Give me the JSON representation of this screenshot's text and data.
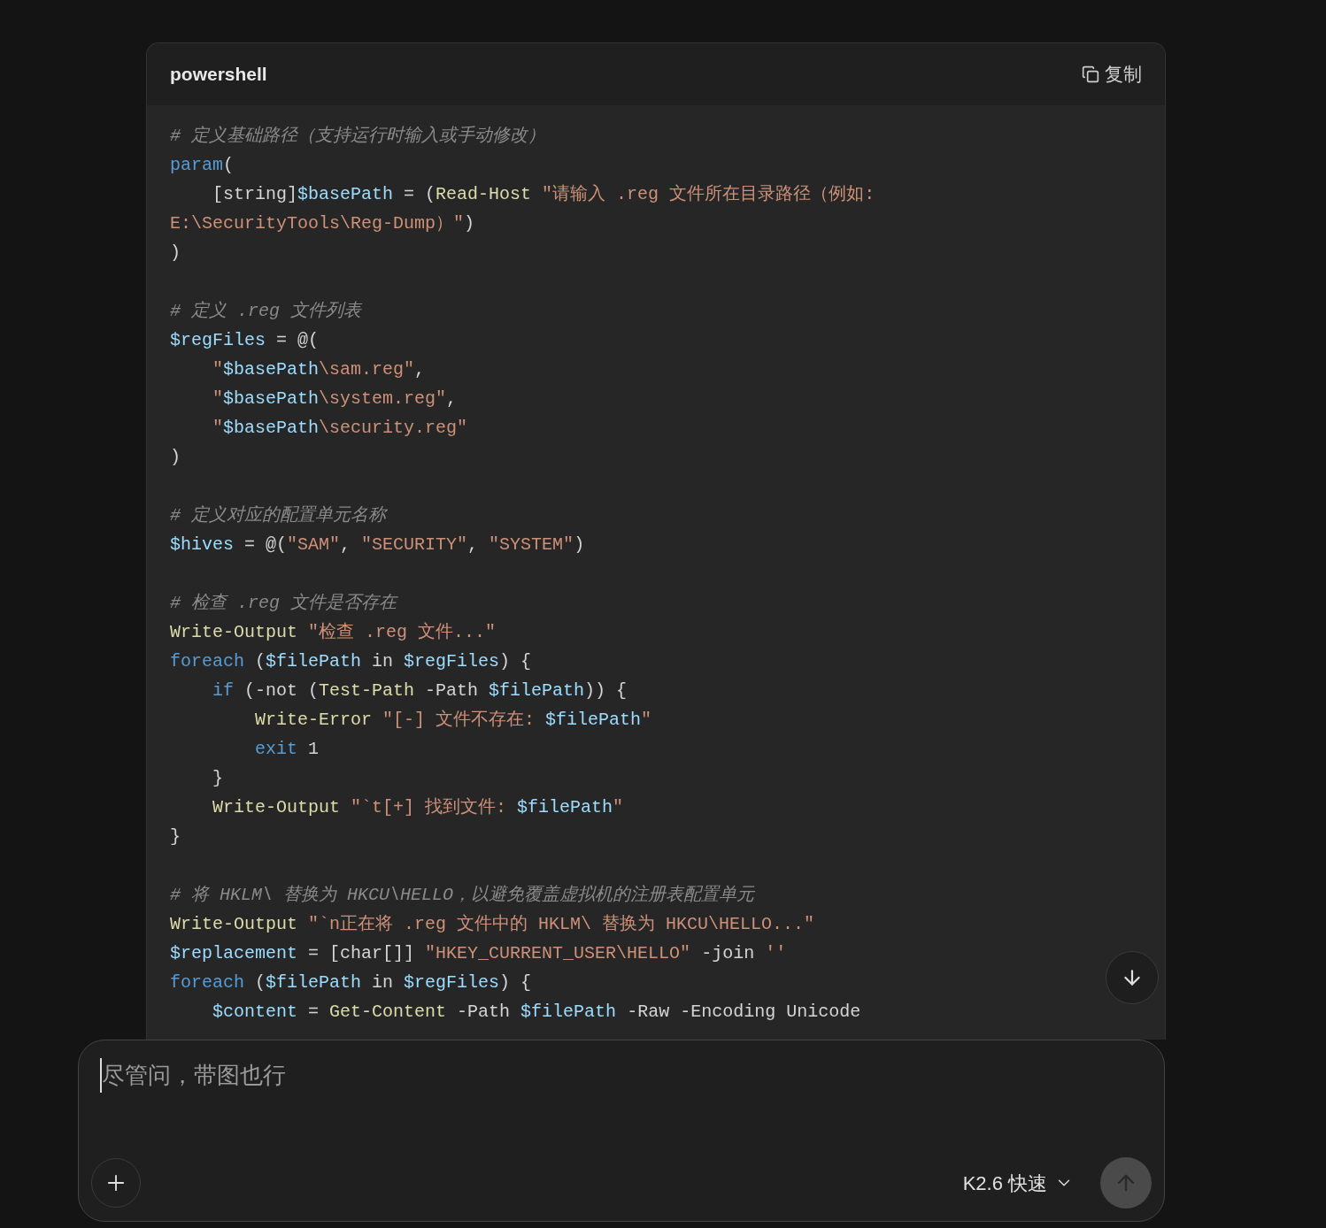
{
  "code_block": {
    "language": "powershell",
    "copy_label": "复制",
    "lines": [
      {
        "kind": "code",
        "tokens": [
          {
            "kind": "comment",
            "text": "# 定义基础路径（支持运行时输入或手动修改）"
          }
        ]
      },
      {
        "kind": "code",
        "tokens": [
          {
            "kind": "keyword",
            "text": "param"
          },
          {
            "kind": "plain",
            "text": "("
          }
        ]
      },
      {
        "kind": "code",
        "tokens": [
          {
            "kind": "plain",
            "text": "    [string]"
          },
          {
            "kind": "variable",
            "text": "$basePath"
          },
          {
            "kind": "plain",
            "text": " = ("
          },
          {
            "kind": "cmdlet",
            "text": "Read-Host"
          },
          {
            "kind": "string",
            "text": " \"请输入 .reg 文件所在目录路径（例如:"
          }
        ]
      },
      {
        "kind": "code",
        "tokens": [
          {
            "kind": "string",
            "text": "E:\\SecurityTools\\Reg-Dump）\""
          },
          {
            "kind": "plain",
            "text": ")"
          }
        ]
      },
      {
        "kind": "code",
        "tokens": [
          {
            "kind": "plain",
            "text": ")"
          }
        ]
      },
      {
        "kind": "blank"
      },
      {
        "kind": "code",
        "tokens": [
          {
            "kind": "comment",
            "text": "# 定义 .reg 文件列表"
          }
        ]
      },
      {
        "kind": "code",
        "tokens": [
          {
            "kind": "variable",
            "text": "$regFiles"
          },
          {
            "kind": "plain",
            "text": " = @("
          }
        ]
      },
      {
        "kind": "code",
        "tokens": [
          {
            "kind": "string",
            "text": "    \""
          },
          {
            "kind": "variable",
            "text": "$basePath"
          },
          {
            "kind": "string",
            "text": "\\sam.reg\""
          },
          {
            "kind": "plain",
            "text": ","
          }
        ]
      },
      {
        "kind": "code",
        "tokens": [
          {
            "kind": "string",
            "text": "    \""
          },
          {
            "kind": "variable",
            "text": "$basePath"
          },
          {
            "kind": "string",
            "text": "\\system.reg\""
          },
          {
            "kind": "plain",
            "text": ","
          }
        ]
      },
      {
        "kind": "code",
        "tokens": [
          {
            "kind": "string",
            "text": "    \""
          },
          {
            "kind": "variable",
            "text": "$basePath"
          },
          {
            "kind": "string",
            "text": "\\security.reg\""
          }
        ]
      },
      {
        "kind": "code",
        "tokens": [
          {
            "kind": "plain",
            "text": ")"
          }
        ]
      },
      {
        "kind": "blank"
      },
      {
        "kind": "code",
        "tokens": [
          {
            "kind": "comment",
            "text": "# 定义对应的配置单元名称"
          }
        ]
      },
      {
        "kind": "code",
        "tokens": [
          {
            "kind": "variable",
            "text": "$hives"
          },
          {
            "kind": "plain",
            "text": " = @("
          },
          {
            "kind": "string",
            "text": "\"SAM\""
          },
          {
            "kind": "plain",
            "text": ", "
          },
          {
            "kind": "string",
            "text": "\"SECURITY\""
          },
          {
            "kind": "plain",
            "text": ", "
          },
          {
            "kind": "string",
            "text": "\"SYSTEM\""
          },
          {
            "kind": "plain",
            "text": ")"
          }
        ]
      },
      {
        "kind": "blank"
      },
      {
        "kind": "code",
        "tokens": [
          {
            "kind": "comment",
            "text": "# 检查 .reg 文件是否存在"
          }
        ]
      },
      {
        "kind": "code",
        "tokens": [
          {
            "kind": "cmdlet",
            "text": "Write-Output"
          },
          {
            "kind": "string",
            "text": " \"检查 .reg 文件...\""
          }
        ]
      },
      {
        "kind": "code",
        "tokens": [
          {
            "kind": "keyword",
            "text": "foreach"
          },
          {
            "kind": "plain",
            "text": " ("
          },
          {
            "kind": "variable",
            "text": "$filePath"
          },
          {
            "kind": "plain",
            "text": " in "
          },
          {
            "kind": "variable",
            "text": "$regFiles"
          },
          {
            "kind": "plain",
            "text": ") {"
          }
        ]
      },
      {
        "kind": "code",
        "tokens": [
          {
            "kind": "keyword",
            "text": "    if"
          },
          {
            "kind": "plain",
            "text": " (-not ("
          },
          {
            "kind": "cmdlet",
            "text": "Test-Path"
          },
          {
            "kind": "plain",
            "text": " -Path "
          },
          {
            "kind": "variable",
            "text": "$filePath"
          },
          {
            "kind": "plain",
            "text": ")) {"
          }
        ]
      },
      {
        "kind": "code",
        "tokens": [
          {
            "kind": "cmdlet",
            "text": "        Write-Error"
          },
          {
            "kind": "string",
            "text": " \"[-] 文件不存在: "
          },
          {
            "kind": "variable",
            "text": "$filePath"
          },
          {
            "kind": "string",
            "text": "\""
          }
        ]
      },
      {
        "kind": "code",
        "tokens": [
          {
            "kind": "keyword",
            "text": "        exit"
          },
          {
            "kind": "plain",
            "text": " 1"
          }
        ]
      },
      {
        "kind": "code",
        "tokens": [
          {
            "kind": "plain",
            "text": "    }"
          }
        ]
      },
      {
        "kind": "code",
        "tokens": [
          {
            "kind": "cmdlet",
            "text": "    Write-Output"
          },
          {
            "kind": "string",
            "text": " \"`t[+] 找到文件: "
          },
          {
            "kind": "variable",
            "text": "$filePath"
          },
          {
            "kind": "string",
            "text": "\""
          }
        ]
      },
      {
        "kind": "code",
        "tokens": [
          {
            "kind": "plain",
            "text": "}"
          }
        ]
      },
      {
        "kind": "blank"
      },
      {
        "kind": "code",
        "tokens": [
          {
            "kind": "comment",
            "text": "# 将 HKLM\\ 替换为 HKCU\\HELLO，以避免覆盖虚拟机的注册表配置单元"
          }
        ]
      },
      {
        "kind": "code",
        "tokens": [
          {
            "kind": "cmdlet",
            "text": "Write-Output"
          },
          {
            "kind": "string",
            "text": " \"`n正在将 .reg 文件中的 HKLM\\ 替换为 HKCU\\HELLO...\""
          }
        ]
      },
      {
        "kind": "code",
        "tokens": [
          {
            "kind": "variable",
            "text": "$replacement"
          },
          {
            "kind": "plain",
            "text": " = [char[]] "
          },
          {
            "kind": "string",
            "text": "\"HKEY_CURRENT_USER\\HELLO\""
          },
          {
            "kind": "plain",
            "text": " -join "
          },
          {
            "kind": "string",
            "text": "''"
          }
        ]
      },
      {
        "kind": "code",
        "tokens": [
          {
            "kind": "keyword",
            "text": "foreach"
          },
          {
            "kind": "plain",
            "text": " ("
          },
          {
            "kind": "variable",
            "text": "$filePath"
          },
          {
            "kind": "plain",
            "text": " in "
          },
          {
            "kind": "variable",
            "text": "$regFiles"
          },
          {
            "kind": "plain",
            "text": ") {"
          }
        ]
      },
      {
        "kind": "code",
        "tokens": [
          {
            "kind": "variable",
            "text": "    $content"
          },
          {
            "kind": "plain",
            "text": " = "
          },
          {
            "kind": "cmdlet",
            "text": "Get-Content"
          },
          {
            "kind": "plain",
            "text": " -Path "
          },
          {
            "kind": "variable",
            "text": "$filePath"
          },
          {
            "kind": "plain",
            "text": " -Raw -Encoding Unicode"
          }
        ]
      }
    ]
  },
  "composer": {
    "placeholder": "尽管问，带图也行",
    "model": "K2.6 快速",
    "send_disabled": true
  }
}
